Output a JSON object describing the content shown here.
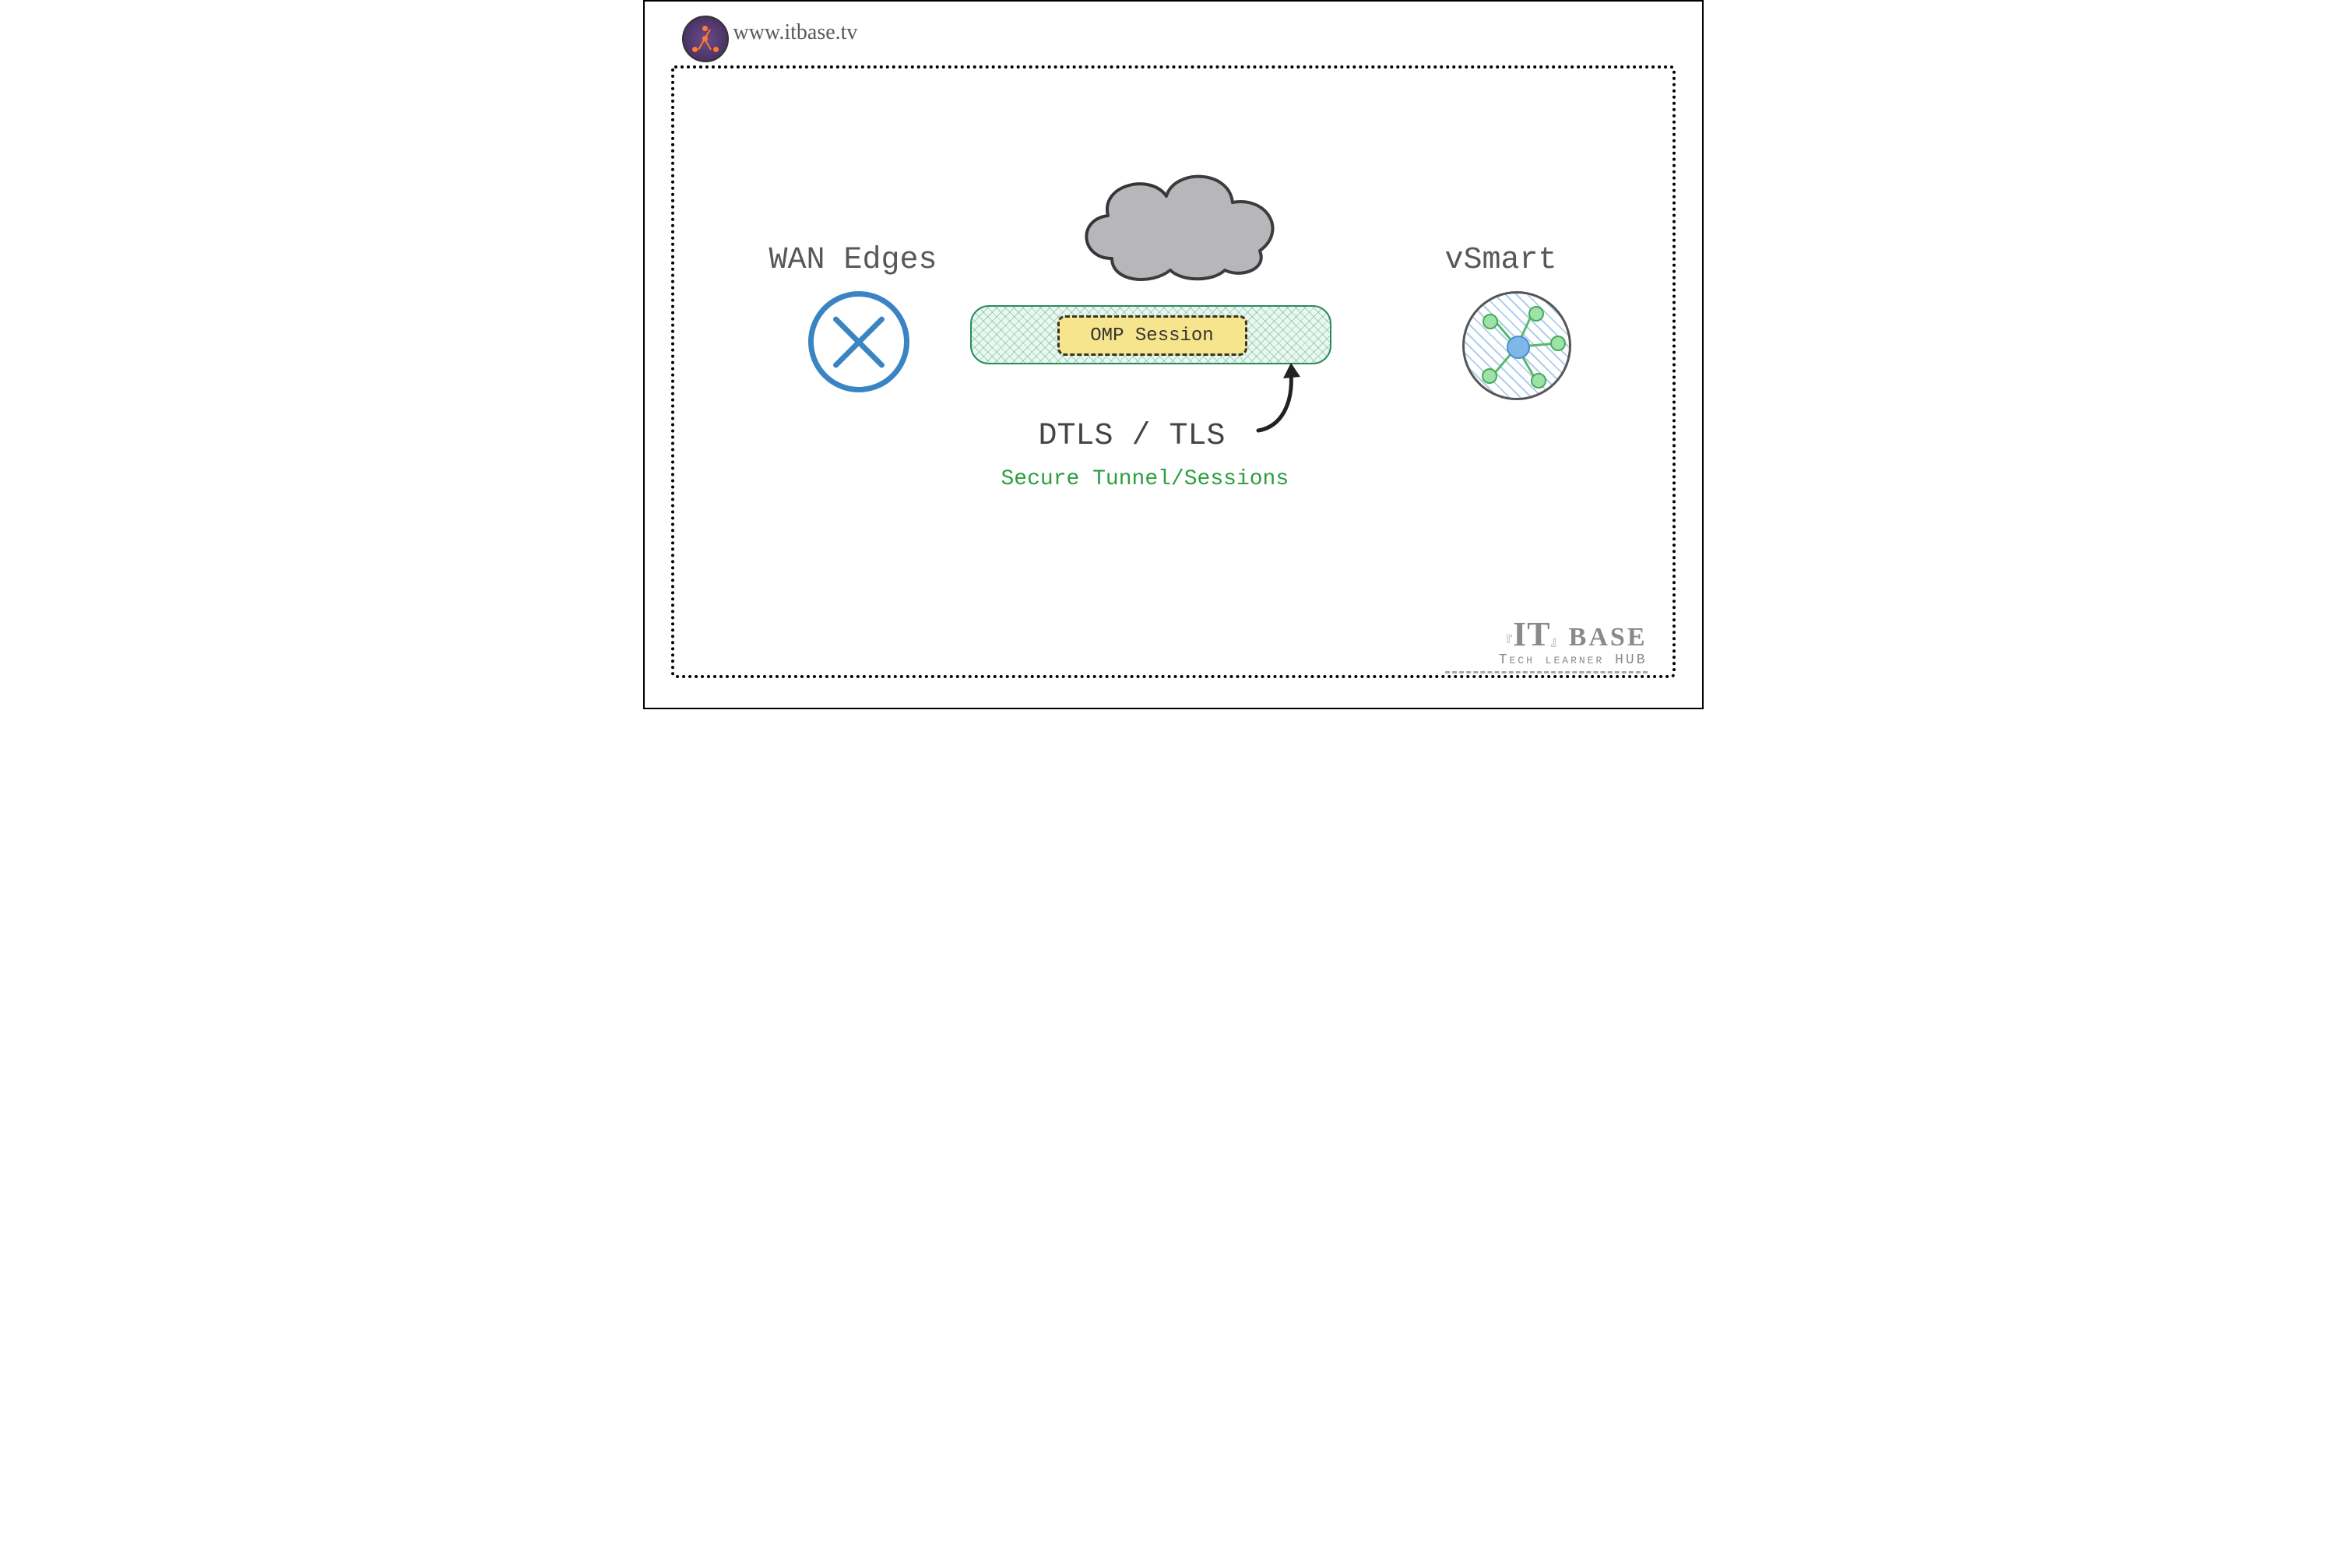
{
  "header": {
    "url": "www.itbase.tv",
    "logo_text": "itbase"
  },
  "labels": {
    "left": "WAN Edges",
    "right": "vSmart",
    "omp": "OMP Session",
    "dtls": "DTLS / TLS",
    "secure": "Secure Tunnel/Sessions"
  },
  "brand": {
    "it": "IT",
    "base": "BASE",
    "sub": "Tech learner HUB",
    "lbracket": "『",
    "rbracket": "』"
  },
  "colors": {
    "blue": "#3b84c4",
    "green_stroke": "#2a8a5e",
    "green_text": "#2d9d3f",
    "omp_fill": "#f6e58d",
    "cloud_fill": "#b7b6bb",
    "gray_text": "#585858"
  }
}
